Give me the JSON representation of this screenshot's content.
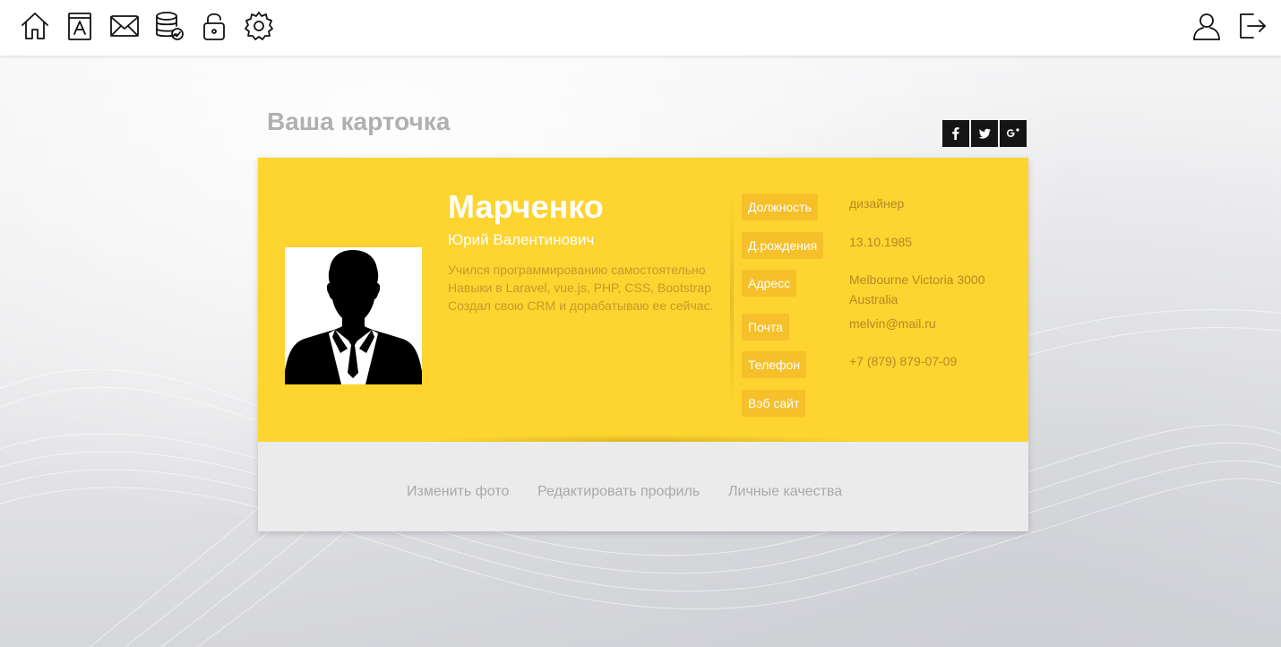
{
  "toolbar": {
    "left_icons": [
      "home-icon",
      "address-book-icon",
      "mail-icon",
      "database-icon",
      "lock-icon",
      "gear-icon"
    ],
    "right_icons": [
      "user-icon",
      "logout-icon"
    ]
  },
  "page": {
    "title": "Ваша карточка"
  },
  "social": [
    "facebook-icon",
    "twitter-icon",
    "google-plus-icon"
  ],
  "profile": {
    "surname": "Марченко",
    "given_names": "Юрий Валентинович",
    "bio": [
      "Учился программированию самостоятельно",
      "Навыки в Laravel, vue.js, PHP, CSS, Bootstrap",
      "Создал свою CRM и дорабатываю ее сейчас."
    ],
    "photo_icon": "person-silhouette-icon"
  },
  "info": {
    "position_label": "Должность",
    "position_value": "дизайнер",
    "birth_label": "Д.рождения",
    "birth_value": "13.10.1985",
    "address_label": "Адресс",
    "address_line1": "Melbourne Victoria 3000",
    "address_line2": "Australia",
    "mail_label": "Почта",
    "mail_value": "melvin@mail.ru",
    "phone_label": "Телефон",
    "phone_value": "+7 (879) 879-07-09",
    "site_label": "Вэб сайт"
  },
  "actions": {
    "change_photo": "Изменить фото",
    "edit_profile": "Редактировать профиль",
    "personal_qualities": "Личные качества"
  },
  "colors": {
    "card_yellow": "#fdd430",
    "label_yellow": "#f5c02a",
    "bottom_gray": "#ebebeb",
    "title_gray": "#b0b0b0"
  }
}
